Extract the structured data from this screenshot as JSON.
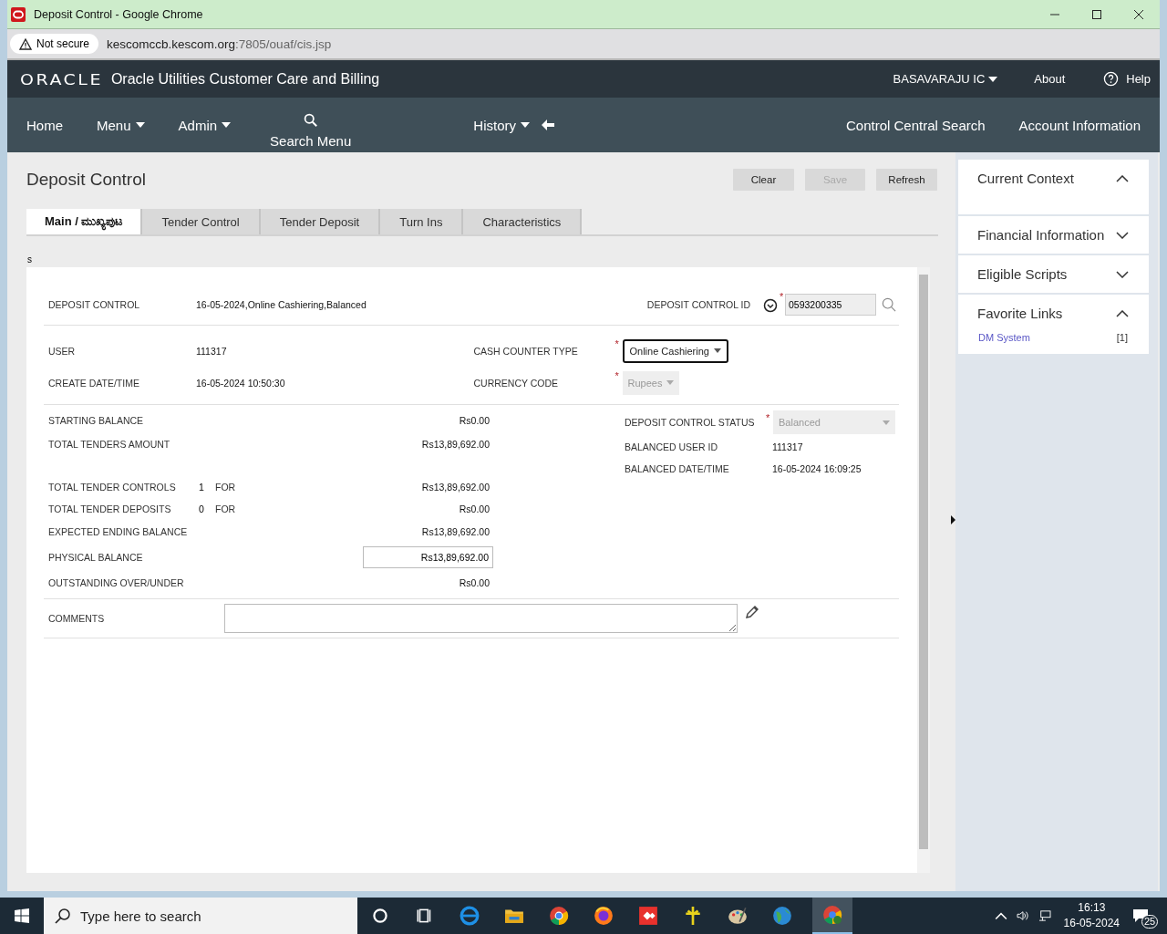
{
  "browser": {
    "title": "Deposit Control - Google Chrome",
    "security": "Not secure",
    "url_host": "kescomccb.kescom.org",
    "url_rest": ":7805/ouaf/cis.jsp"
  },
  "app": {
    "logo": "ORACLE",
    "product": "Oracle Utilities Customer Care and Billing",
    "user": "BASAVARAJU IC",
    "about": "About",
    "help": "Help"
  },
  "nav": {
    "left": [
      {
        "label": "Home",
        "dropdown": false
      },
      {
        "label": "Menu",
        "dropdown": true
      },
      {
        "label": "Admin",
        "dropdown": true
      }
    ],
    "search": "Search Menu",
    "history": "History",
    "right": [
      "Control Central Search",
      "Account Information"
    ]
  },
  "page": {
    "title": "Deposit Control",
    "buttons": [
      {
        "label": "Clear",
        "disabled": false
      },
      {
        "label": "Save",
        "disabled": true
      },
      {
        "label": "Refresh",
        "disabled": false
      }
    ],
    "tabs": [
      {
        "label": "Main / ಮುಖ್ಯಪುಟ",
        "selected": true
      },
      {
        "label": "Tender Control",
        "selected": false
      },
      {
        "label": "Tender Deposit",
        "selected": false
      },
      {
        "label": "Turn Ins",
        "selected": false
      },
      {
        "label": "Characteristics",
        "selected": false
      }
    ],
    "section_label": "s"
  },
  "form": {
    "deposit_control": {
      "label": "DEPOSIT CONTROL",
      "value": "16-05-2024,Online Cashiering,Balanced"
    },
    "deposit_control_id": {
      "label": "DEPOSIT CONTROL ID",
      "value": "0593200335",
      "required_mark": "*"
    },
    "user": {
      "label": "USER",
      "value": "111317"
    },
    "create_datetime": {
      "label": "CREATE DATE/TIME",
      "value": "16-05-2024 10:50:30"
    },
    "cash_counter_type": {
      "label": "CASH COUNTER TYPE",
      "value": "Online Cashiering",
      "required_mark": "*",
      "disabled": false
    },
    "currency_code": {
      "label": "CURRENCY CODE",
      "value": "Rupees",
      "required_mark": "*",
      "disabled": true
    },
    "balances": [
      {
        "kind": "text",
        "label": "STARTING BALANCE",
        "amount": "Rs0.00"
      },
      {
        "kind": "text",
        "label": "TOTAL TENDERS AMOUNT",
        "amount": "Rs13,89,692.00"
      },
      {
        "kind": "count",
        "label": "TOTAL TENDER CONTROLS",
        "count": "1",
        "for": "FOR",
        "amount": "Rs13,89,692.00"
      },
      {
        "kind": "count",
        "label": "TOTAL TENDER DEPOSITS",
        "count": "0",
        "for": "FOR",
        "amount": "Rs0.00"
      },
      {
        "kind": "text",
        "label": "EXPECTED ENDING BALANCE",
        "amount": "Rs13,89,692.00"
      },
      {
        "kind": "input",
        "label": "PHYSICAL BALANCE",
        "amount": "Rs13,89,692.00"
      },
      {
        "kind": "text",
        "label": "OUTSTANDING OVER/UNDER",
        "amount": "Rs0.00"
      }
    ],
    "status": {
      "label": "DEPOSIT CONTROL STATUS",
      "value": "Balanced",
      "required_mark": "*",
      "disabled": true
    },
    "balanced_user": {
      "label": "BALANCED USER ID",
      "value": "111317"
    },
    "balanced_datetime": {
      "label": "BALANCED DATE/TIME",
      "value": "16-05-2024 16:09:25"
    },
    "comments": {
      "label": "COMMENTS"
    }
  },
  "side_panel": [
    {
      "title": "Current Context",
      "expanded": true
    },
    {
      "title": "Financial Information",
      "expanded": false
    },
    {
      "title": "Eligible Scripts",
      "expanded": false
    },
    {
      "title": "Favorite Links",
      "expanded": true,
      "links": [
        {
          "label": "DM System",
          "count": "[1]"
        }
      ]
    }
  ],
  "taskbar": {
    "search_placeholder": "Type here to search",
    "time": "16:13",
    "date": "16-05-2024",
    "notifications": "25"
  }
}
